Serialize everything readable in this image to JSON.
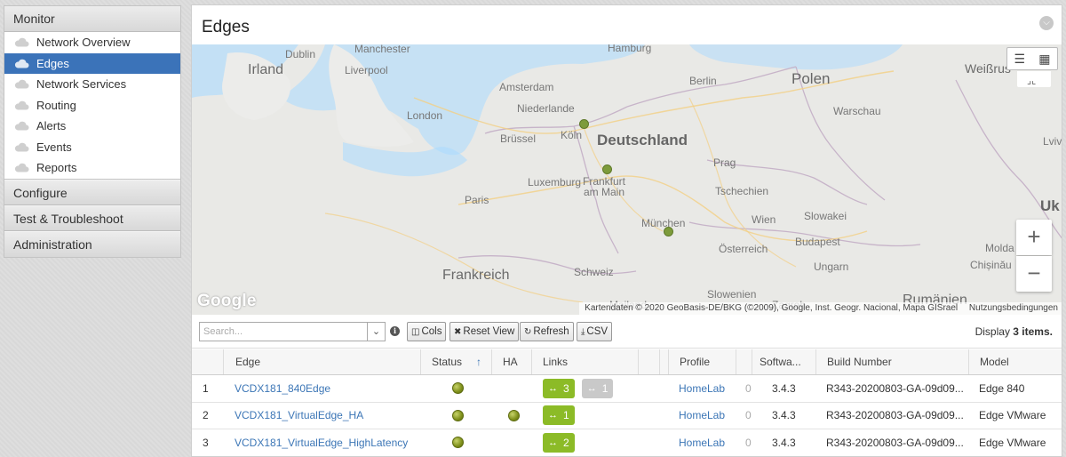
{
  "sidebar": {
    "monitor_label": "Monitor",
    "items": [
      {
        "label": "Network Overview",
        "active": false
      },
      {
        "label": "Edges",
        "active": true
      },
      {
        "label": "Network Services",
        "active": false
      },
      {
        "label": "Routing",
        "active": false
      },
      {
        "label": "Alerts",
        "active": false
      },
      {
        "label": "Events",
        "active": false
      },
      {
        "label": "Reports",
        "active": false
      }
    ],
    "sections": [
      "Configure",
      "Test & Troubleshoot",
      "Administration"
    ]
  },
  "page": {
    "title": "Edges"
  },
  "map": {
    "labels": {
      "hamburg": "Hamburg",
      "manchester": "Manchester",
      "dublin": "Dublin",
      "irland": "Irland",
      "liverpool": "Liverpool",
      "amsterdam": "Amsterdam",
      "berlin": "Berlin",
      "polen": "Polen",
      "weissrussland": "Weißrus",
      "niederlande": "Niederlande",
      "london": "London",
      "warschau": "Warschau",
      "koeln": "Köln",
      "deutschland": "Deutschland",
      "bruessel": "Brüssel",
      "lviv": "Lviv",
      "prag": "Prag",
      "luxemburg": "Luxemburg",
      "frankfurt": "Frankfurt\nam Main",
      "tschechien": "Tschechien",
      "ukr": "Uk",
      "paris": "Paris",
      "muenchen": "München",
      "wien": "Wien",
      "slowakei": "Slowakei",
      "oesterreich": "Österreich",
      "budapest": "Budapest",
      "moldau": "Molda",
      "chisinau": "Chișinău",
      "frankreich": "Frankreich",
      "schweiz": "Schweiz",
      "ungarn": "Ungarn",
      "slowenien": "Slowenien",
      "mailand": "Mailand",
      "zagreb": "Zagreb",
      "rumaenien": "Rumänien"
    },
    "google_logo": "Google",
    "attribution": "Kartendaten © 2020 GeoBasis-DE/BKG (©2009), Google, Inst. Geogr. Nacional, Mapa GISrael",
    "terms": "Nutzungsbedingungen",
    "zoom_in": "+",
    "zoom_out": "−"
  },
  "toolbar": {
    "search_placeholder": "Search...",
    "cols_label": "Cols",
    "reset_label": "Reset View",
    "refresh_label": "Refresh",
    "csv_label": "CSV",
    "display_prefix": "Display",
    "display_count": "3 items."
  },
  "table": {
    "columns": {
      "edge": "Edge",
      "status": "Status",
      "ha": "HA",
      "links": "Links",
      "profile": "Profile",
      "software": "Softwa...",
      "build": "Build Number",
      "model": "Model"
    },
    "rows": [
      {
        "index": "1",
        "edge": "VCDX181_840Edge",
        "status": "up",
        "ha": "",
        "links_up": "3",
        "links_down": "1",
        "profile": "HomeLab",
        "profile_count": "0",
        "software": "3.4.3",
        "build": "R343-20200803-GA-09d09...",
        "model": "Edge 840"
      },
      {
        "index": "2",
        "edge": "VCDX181_VirtualEdge_HA",
        "status": "up",
        "ha": "up",
        "links_up": "1",
        "links_down": "",
        "profile": "HomeLab",
        "profile_count": "0",
        "software": "3.4.3",
        "build": "R343-20200803-GA-09d09...",
        "model": "Edge VMware"
      },
      {
        "index": "3",
        "edge": "VCDX181_VirtualEdge_HighLatency",
        "status": "up",
        "ha": "",
        "links_up": "2",
        "links_down": "",
        "profile": "HomeLab",
        "profile_count": "0",
        "software": "3.4.3",
        "build": "R343-20200803-GA-09d09...",
        "model": "Edge VMware"
      }
    ]
  }
}
